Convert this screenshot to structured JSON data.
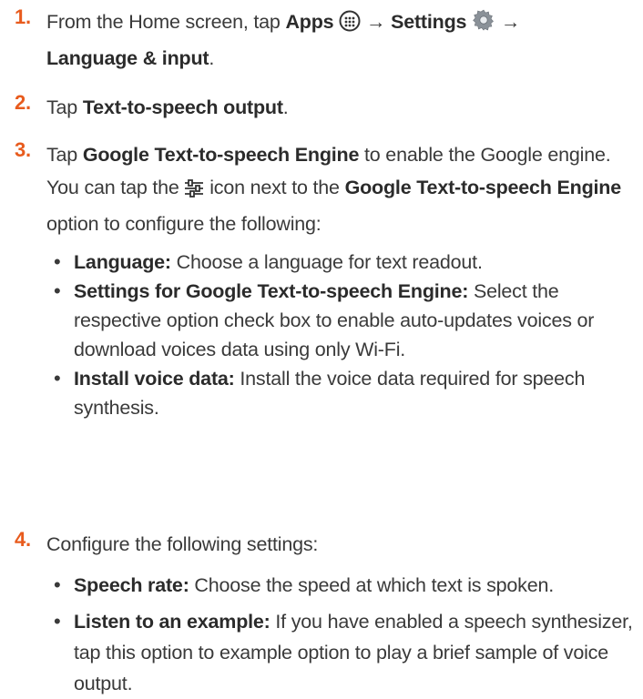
{
  "steps": [
    {
      "number": "1.",
      "text_a": "From the Home screen, tap ",
      "apps_label": "Apps",
      "apps_icon": "apps-grid-icon",
      "arrow1": " → ",
      "settings_label": "Settings",
      "settings_icon": "gear-icon",
      "arrow2": " → ",
      "lang_label": "Language & input",
      "period": "."
    },
    {
      "number": "2.",
      "text_a": "Tap ",
      "bold": "Text-to-speech output",
      "period": "."
    },
    {
      "number": "3.",
      "text_a": "Tap ",
      "bold": "Google Text-to-speech Engine",
      "text_b": " to enable the Google engine.",
      "note_a": "You can tap the ",
      "note_icon": "settings-sliders-icon",
      "note_b": " icon next to the ",
      "note_bold": "Google Text-to-speech Engine",
      "note_c": " option to configure the following:",
      "bullets": [
        {
          "label": "Language:",
          "text": " Choose a language for text readout."
        },
        {
          "label": "Settings for Google Text-to-speech Engine:",
          "text": " Select the respective option check box to enable auto-updates voices or download voices data using only Wi-Fi."
        },
        {
          "label": "Install voice data:",
          "text": " Install the voice data required for speech synthesis."
        }
      ]
    },
    {
      "number": "4.",
      "text_a": "Configure the following settings:",
      "bullets": [
        {
          "label": "Speech rate:",
          "text": " Choose the speed at which text is spoken."
        },
        {
          "label": "Listen to an example:",
          "text": " If you have enabled a speech synthesizer, tap this option to example option to play a brief sample of voice output."
        }
      ]
    }
  ],
  "colors": {
    "accent": "#e85b1d",
    "text": "#3a3a3a"
  }
}
